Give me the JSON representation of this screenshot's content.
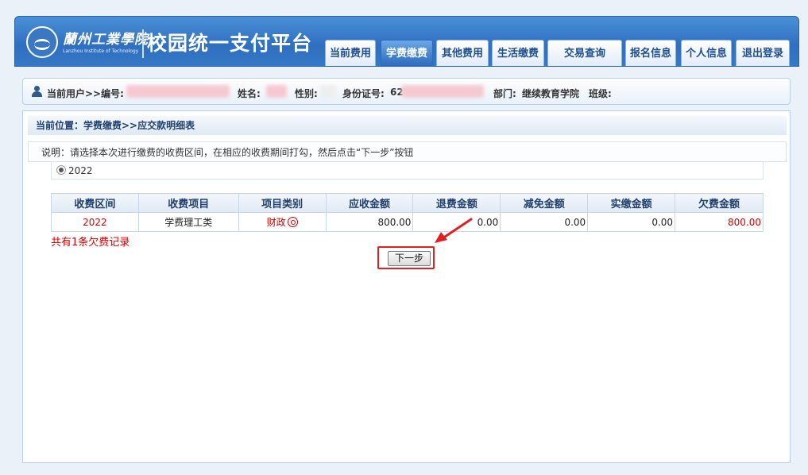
{
  "header": {
    "school_name": "蘭州工業學院",
    "school_en": "Lanzhou Institute of Technology",
    "platform_title": "校园统一支付平台",
    "tabs": [
      {
        "label": "当前费用"
      },
      {
        "label": "学费缴费"
      },
      {
        "label": "其他费用"
      },
      {
        "label": "生活缴费"
      },
      {
        "label": "交易查询"
      },
      {
        "label": "报名信息"
      },
      {
        "label": "个人信息"
      },
      {
        "label": "退出登录"
      }
    ],
    "active_tab": "学费缴费"
  },
  "userbar": {
    "current_user_label": "当前用户>>编号:",
    "name_label": "姓名:",
    "gender_label": "性别:",
    "id_label": "身份证号:",
    "id_value_partial": "62",
    "dept_label": "部门:",
    "dept_value": "继续教育学院",
    "class_label": "班级:"
  },
  "breadcrumb": "当前位置：学费缴费>>应交款明细表",
  "note": "说明：请选择本次进行缴费的收费区间，在相应的收费期间打勾，然后点击“下一步”按钮",
  "period": {
    "label": "2022"
  },
  "table": {
    "headers": [
      "收费区间",
      "收费项目",
      "项目类别",
      "应收金额",
      "退费金额",
      "减免金额",
      "实缴金额",
      "欠费金额"
    ],
    "rows": [
      {
        "period": "2022",
        "item": "学费理工类",
        "category": "财政",
        "receivable": "800.00",
        "refund": "0.00",
        "waived": "0.00",
        "paid": "0.00",
        "arrears": "800.00"
      }
    ]
  },
  "summary": "共有1条欠费记录",
  "next_button": "下一步",
  "colors": {
    "accent": "#2f6fbf",
    "alert": "#d40000",
    "highlight_box": "#e02020"
  }
}
